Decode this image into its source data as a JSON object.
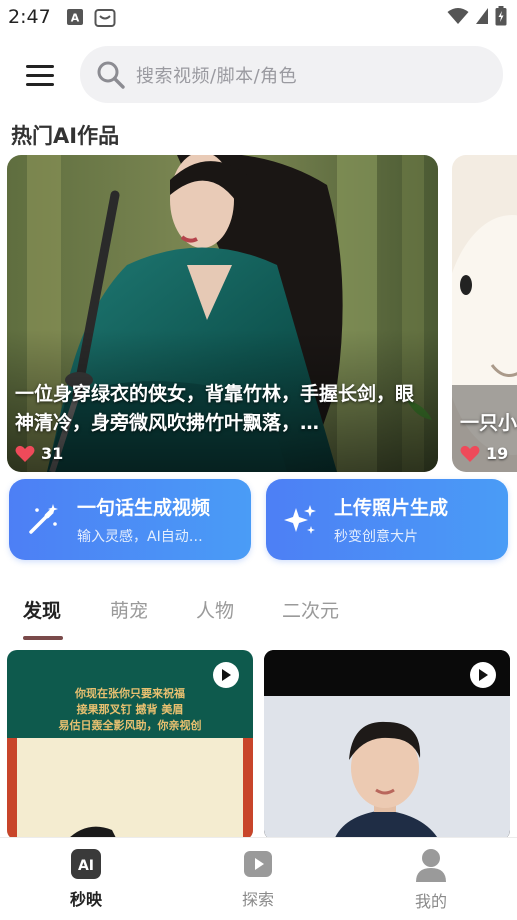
{
  "status_bar": {
    "time": "2:47"
  },
  "search": {
    "placeholder": "搜索视频/脚本/角色"
  },
  "hot_section": {
    "title": "热门AI作品",
    "cards": [
      {
        "caption": "一位身穿绿衣的侠女，背靠竹林，手握长剑，眼神清冷，身旁微风吹拂竹叶飘落，…",
        "likes": "31"
      },
      {
        "caption": "一只小",
        "likes": "19"
      }
    ]
  },
  "actions": [
    {
      "title": "一句话生成视频",
      "subtitle": "输入灵感，AI自动…",
      "icon": "magic-wand-icon"
    },
    {
      "title": "上传照片生成",
      "subtitle": "秒变创意大片",
      "icon": "sparkle-icon"
    }
  ],
  "tabs": [
    {
      "label": "发现",
      "active": true
    },
    {
      "label": "萌宠",
      "active": false
    },
    {
      "label": "人物",
      "active": false
    },
    {
      "label": "二次元",
      "active": false
    }
  ],
  "feed": {
    "card1_lines": [
      "你现在张你只要来祝福",
      "接果那叉钉 撼背 美眉",
      "易估日轰全影风助，你亲视创"
    ]
  },
  "bottom_nav": [
    {
      "label": "秒映",
      "icon": "ai-icon",
      "active": true
    },
    {
      "label": "探索",
      "icon": "play-icon",
      "active": false
    },
    {
      "label": "我的",
      "icon": "person-icon",
      "active": false
    }
  ],
  "colors": {
    "accent_blue": "#4d7ff5",
    "heart_red": "#ef4a5a",
    "tab_underline": "#7a4a4a"
  }
}
